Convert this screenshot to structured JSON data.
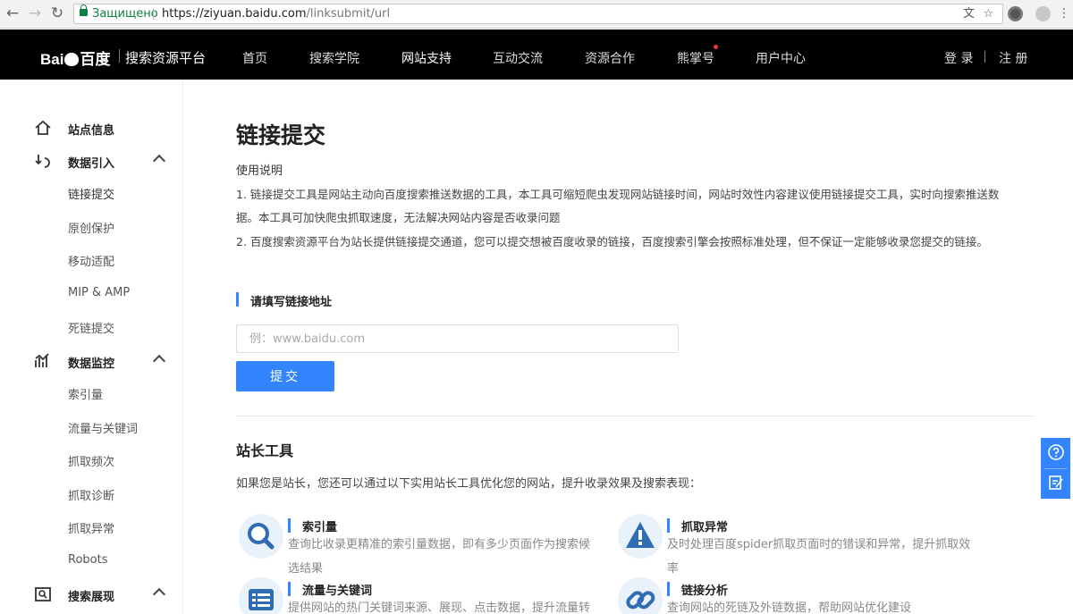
{
  "browser": {
    "secure_label": "Защищено",
    "url_host": "https://ziyuan.baidu.com",
    "url_path": "/linksubmit/url"
  },
  "header": {
    "logo_text_left": "Bai",
    "logo_text_right": "百度",
    "platform_name": "搜索资源平台",
    "nav": [
      "首页",
      "搜索学院",
      "网站支持",
      "互动交流",
      "资源合作",
      "熊掌号",
      "用户中心"
    ],
    "active_nav": "网站支持",
    "login": "登 录",
    "register": "注 册"
  },
  "sidebar": {
    "site_info": "站点信息",
    "data_import": {
      "title": "数据引入",
      "items": [
        "链接提交",
        "原创保护",
        "移动适配",
        "MIP & AMP",
        "死链提交"
      ]
    },
    "data_monitor": {
      "title": "数据监控",
      "items": [
        "索引量",
        "流量与关键词",
        "抓取频次",
        "抓取诊断",
        "抓取异常",
        "Robots"
      ]
    },
    "search_display": {
      "title": "搜索展现"
    }
  },
  "main": {
    "title": "链接提交",
    "usage_heading": "使用说明",
    "usage_lines": [
      "1. 链接提交工具是网站主动向百度搜索推送数据的工具，本工具可缩短爬虫发现网站链接时间，网站时效性内容建议使用链接提交工具，实时向搜索推送数",
      "据。本工具可加快爬虫抓取速度，无法解决网站内容是否收录问题",
      "2. 百度搜索资源平台为站长提供链接提交通道，您可以提交想被百度收录的链接，百度搜索引擎会按照标准处理，但不保证一定能够收录您提交的链接。"
    ],
    "form_label": "请填写链接地址",
    "input_placeholder": "例：www.baidu.com",
    "input_value": "",
    "submit_label": "提交",
    "tools_title": "站长工具",
    "tools_desc": "如果您是站长，您还可以通过以下实用站长工具优化您的网站，提升收录效果及搜索表现：",
    "tools": [
      {
        "name": "索引量",
        "desc": "查询比收录更精准的索引量数据，即有多少页面作为搜索候选结果",
        "icon": "magnifier-icon"
      },
      {
        "name": "抓取异常",
        "desc": "及时处理百度spider抓取页面时的错误和异常，提升抓取效率",
        "icon": "warning-icon"
      },
      {
        "name": "流量与关键词",
        "desc": "提供网站的热门关键词来源、展现、点击数据，提升流量转",
        "icon": "list-icon"
      },
      {
        "name": "链接分析",
        "desc": "查询网站的死链及外链数据，帮助网站优化建设",
        "icon": "link-icon"
      }
    ]
  },
  "colors": {
    "accent": "#3385ff",
    "header_bg": "#000000",
    "secure_green": "#0b8043",
    "notification_dot": "#e53935"
  }
}
